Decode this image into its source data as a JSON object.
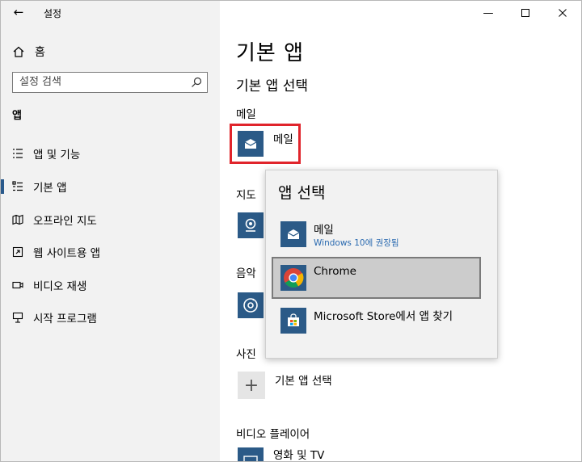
{
  "window": {
    "title": "설정"
  },
  "sidebar": {
    "home_label": "홈",
    "search_placeholder": "설정 검색",
    "section_label": "앱",
    "items": [
      {
        "label": "앱 및 기능",
        "icon": "list-icon",
        "active": false
      },
      {
        "label": "기본 앱",
        "icon": "default-apps-icon",
        "active": true
      },
      {
        "label": "오프라인 지도",
        "icon": "map-icon",
        "active": false
      },
      {
        "label": "웹 사이트용 앱",
        "icon": "web-app-icon",
        "active": false
      },
      {
        "label": "비디오 재생",
        "icon": "video-icon",
        "active": false
      },
      {
        "label": "시작 프로그램",
        "icon": "startup-icon",
        "active": false
      }
    ]
  },
  "main": {
    "title": "기본 앱",
    "subtitle": "기본 앱 선택",
    "categories": {
      "mail": {
        "label": "메일",
        "app": "메일"
      },
      "maps": {
        "label": "지도"
      },
      "music": {
        "label": "음악"
      },
      "photos": {
        "label": "사진"
      },
      "photos_app": "기본 앱 선택",
      "video": {
        "label": "비디오 플레이어",
        "app": "영화 및 TV"
      }
    }
  },
  "popup": {
    "title": "앱 선택",
    "items": [
      {
        "name": "메일",
        "subtitle": "Windows 10에 권장됨",
        "icon": "mail-icon"
      },
      {
        "name": "Chrome",
        "subtitle": "",
        "icon": "chrome-icon",
        "selected": true
      },
      {
        "name": "Microsoft Store에서 앱 찾기",
        "subtitle": "",
        "icon": "store-icon"
      }
    ]
  },
  "colors": {
    "accent": "#2b5a87",
    "highlight": "#e0242b",
    "link": "#2a6ab0"
  }
}
